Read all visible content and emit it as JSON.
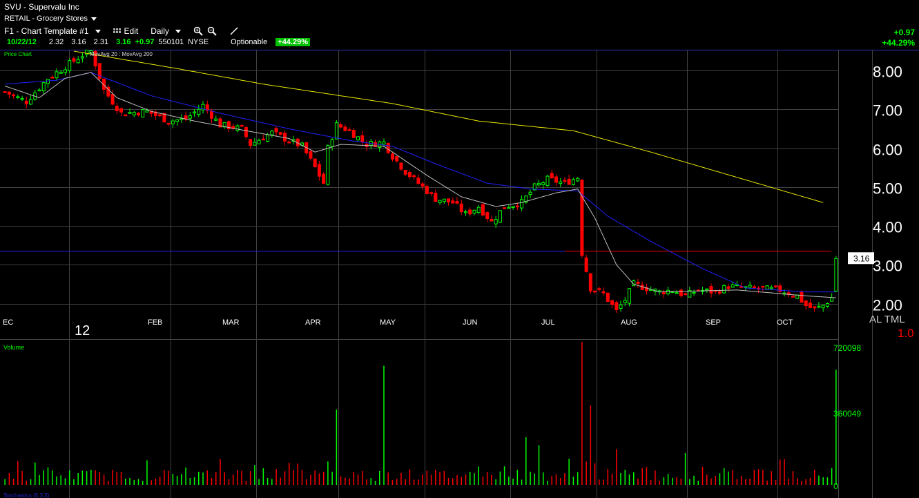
{
  "header": {
    "title": "SVU - Supervalu Inc",
    "sector": "RETAIL - Grocery Stores",
    "template": "F1 - Chart Template #1",
    "edit_label": "Edit",
    "period_label": "Daily",
    "date": "10/22/12",
    "open": "2.32",
    "high": "3.16",
    "low": "2.31",
    "close": "3.16",
    "change": "+0.97",
    "volume": "550101",
    "exchange": "NYSE",
    "optionable_label": "Optionable",
    "pct_change": "+44.29%",
    "right_change": "+0.97",
    "right_pct": "+44.29%"
  },
  "colors": {
    "up": "#00ff00",
    "down": "#ff0000",
    "ma20": "#c0c0c0",
    "ma50": "#2020ff",
    "ma200": "#e8e800",
    "grid": "#404040",
    "border": "#3030c0"
  },
  "chart_data": [
    {
      "type": "candlestick",
      "title": "Price Chart",
      "legend": [
        "MovAvg 20",
        "MovAvg 200"
      ],
      "ylim": [
        1.6,
        8.5
      ],
      "yticks": [
        "8.00",
        "7.00",
        "6.00",
        "5.00",
        "4.00",
        "3.00",
        "2.00"
      ],
      "xticks": [
        "EC",
        "12",
        "FEB",
        "MAR",
        "APR",
        "MAY",
        "JUN",
        "JUL",
        "AUG",
        "SEP",
        "OCT"
      ],
      "last_price_label": "3.16",
      "right_labels": {
        "scale": "AL TML",
        "factor": "1.0"
      },
      "close_keypoints": [
        [
          0,
          7.45
        ],
        [
          5,
          7.2
        ],
        [
          10,
          7.8
        ],
        [
          14,
          8.1
        ],
        [
          18,
          8.4
        ],
        [
          20,
          8.5
        ],
        [
          23,
          7.5
        ],
        [
          27,
          6.9
        ],
        [
          33,
          6.95
        ],
        [
          38,
          6.7
        ],
        [
          42,
          6.75
        ],
        [
          46,
          7.1
        ],
        [
          50,
          6.6
        ],
        [
          55,
          6.5
        ],
        [
          57,
          6.1
        ],
        [
          62,
          6.4
        ],
        [
          66,
          6.2
        ],
        [
          69,
          6.05
        ],
        [
          72,
          5.5
        ],
        [
          74,
          5.1
        ],
        [
          75,
          6.0
        ],
        [
          77,
          6.6
        ],
        [
          80,
          6.45
        ],
        [
          84,
          6.1
        ],
        [
          88,
          6.15
        ],
        [
          90,
          5.8
        ],
        [
          93,
          5.4
        ],
        [
          97,
          5.0
        ],
        [
          100,
          4.7
        ],
        [
          104,
          4.6
        ],
        [
          107,
          4.3
        ],
        [
          110,
          4.5
        ],
        [
          113,
          4.1
        ],
        [
          116,
          4.5
        ],
        [
          120,
          4.6
        ],
        [
          123,
          5.0
        ],
        [
          126,
          5.2
        ],
        [
          130,
          5.1
        ],
        [
          133,
          5.25
        ],
        [
          134,
          3.3
        ],
        [
          136,
          2.4
        ],
        [
          139,
          2.25
        ],
        [
          142,
          1.8
        ],
        [
          144,
          2.1
        ],
        [
          146,
          2.5
        ],
        [
          149,
          2.4
        ],
        [
          152,
          2.3
        ],
        [
          155,
          2.35
        ],
        [
          158,
          2.2
        ],
        [
          161,
          2.35
        ],
        [
          165,
          2.3
        ],
        [
          168,
          2.45
        ],
        [
          172,
          2.4
        ],
        [
          176,
          2.38
        ],
        [
          180,
          2.35
        ],
        [
          184,
          2.2
        ],
        [
          186,
          1.95
        ],
        [
          188,
          1.85
        ],
        [
          190,
          1.95
        ],
        [
          192,
          2.15
        ],
        [
          193,
          3.16
        ]
      ],
      "ma20_keypoints": [
        [
          0,
          7.6
        ],
        [
          8,
          7.3
        ],
        [
          14,
          7.8
        ],
        [
          20,
          7.95
        ],
        [
          26,
          7.3
        ],
        [
          34,
          6.95
        ],
        [
          44,
          6.7
        ],
        [
          56,
          6.45
        ],
        [
          66,
          6.25
        ],
        [
          72,
          5.9
        ],
        [
          78,
          6.1
        ],
        [
          88,
          6.05
        ],
        [
          98,
          5.3
        ],
        [
          106,
          4.75
        ],
        [
          114,
          4.5
        ],
        [
          120,
          4.6
        ],
        [
          128,
          4.85
        ],
        [
          133,
          4.95
        ],
        [
          137,
          4.2
        ],
        [
          142,
          3.0
        ],
        [
          146,
          2.5
        ],
        [
          152,
          2.3
        ],
        [
          170,
          2.35
        ],
        [
          186,
          2.2
        ],
        [
          193,
          2.15
        ]
      ],
      "ma50_keypoints": [
        [
          0,
          7.65
        ],
        [
          12,
          7.75
        ],
        [
          20,
          7.95
        ],
        [
          34,
          7.35
        ],
        [
          50,
          6.9
        ],
        [
          66,
          6.5
        ],
        [
          80,
          6.2
        ],
        [
          90,
          6.05
        ],
        [
          100,
          5.6
        ],
        [
          112,
          5.1
        ],
        [
          122,
          4.95
        ],
        [
          133,
          4.9
        ],
        [
          140,
          4.25
        ],
        [
          150,
          3.6
        ],
        [
          162,
          2.9
        ],
        [
          172,
          2.4
        ],
        [
          186,
          2.3
        ],
        [
          193,
          2.3
        ]
      ],
      "ma200_keypoints": [
        [
          16,
          8.5
        ],
        [
          40,
          8.05
        ],
        [
          60,
          7.65
        ],
        [
          90,
          7.15
        ],
        [
          110,
          6.7
        ],
        [
          132,
          6.45
        ],
        [
          150,
          5.9
        ],
        [
          170,
          5.25
        ],
        [
          190,
          4.6
        ]
      ],
      "resistance_level": 3.35
    },
    {
      "type": "bar",
      "title": "Volume",
      "ylim": [
        0,
        720098
      ],
      "yticks": [
        "720098",
        "360049",
        "0"
      ],
      "spikes": [
        [
          88,
          600000
        ],
        [
          77,
          380000
        ],
        [
          134,
          720000
        ],
        [
          136,
          400000
        ],
        [
          121,
          240000
        ],
        [
          158,
          160000
        ],
        [
          193,
          580000
        ],
        [
          142,
          180000
        ],
        [
          124,
          200000
        ]
      ]
    }
  ],
  "footer": {
    "sub_label": "Stochastics (5,3,3)"
  }
}
